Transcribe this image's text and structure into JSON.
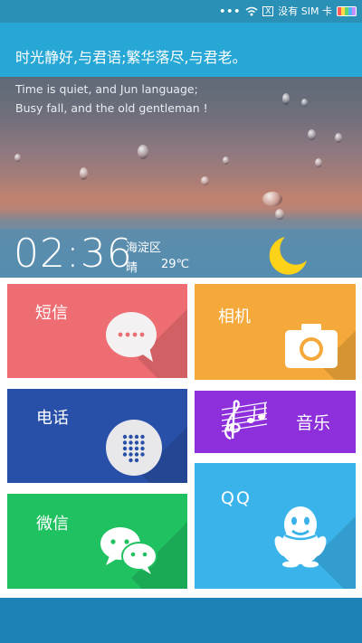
{
  "status": {
    "dots": "•••",
    "no_sim": "没有 SIM 卡",
    "sim_box": "X"
  },
  "banner": {
    "text": "时光静好,与君语;繁华落尽,与君老。"
  },
  "quote": {
    "line1": "Time is quiet, and Jun language;",
    "line2": "Busy fall, and the old gentleman !"
  },
  "widget": {
    "time": "02:36",
    "location": "海淀区",
    "weather": "晴",
    "temperature": "29℃"
  },
  "tiles": {
    "sms": "短信",
    "camera": "相机",
    "phone": "电话",
    "music": "音乐",
    "wechat": "微信",
    "qq": "QQ"
  },
  "colors": {
    "banner": "#27a7d6",
    "sms": "#ee6d72",
    "camera": "#f5a93a",
    "phone": "#2950a8",
    "music": "#8e2fdc",
    "wechat": "#20c161",
    "qq": "#3ab3eb",
    "bottom": "#1d83b7"
  },
  "icons": [
    "wifi-icon",
    "sim-card-icon",
    "battery-icon",
    "moon-icon",
    "chat-bubble-icon",
    "camera-icon",
    "dialpad-icon",
    "music-note-icon",
    "wechat-icon",
    "qq-penguin-icon"
  ]
}
